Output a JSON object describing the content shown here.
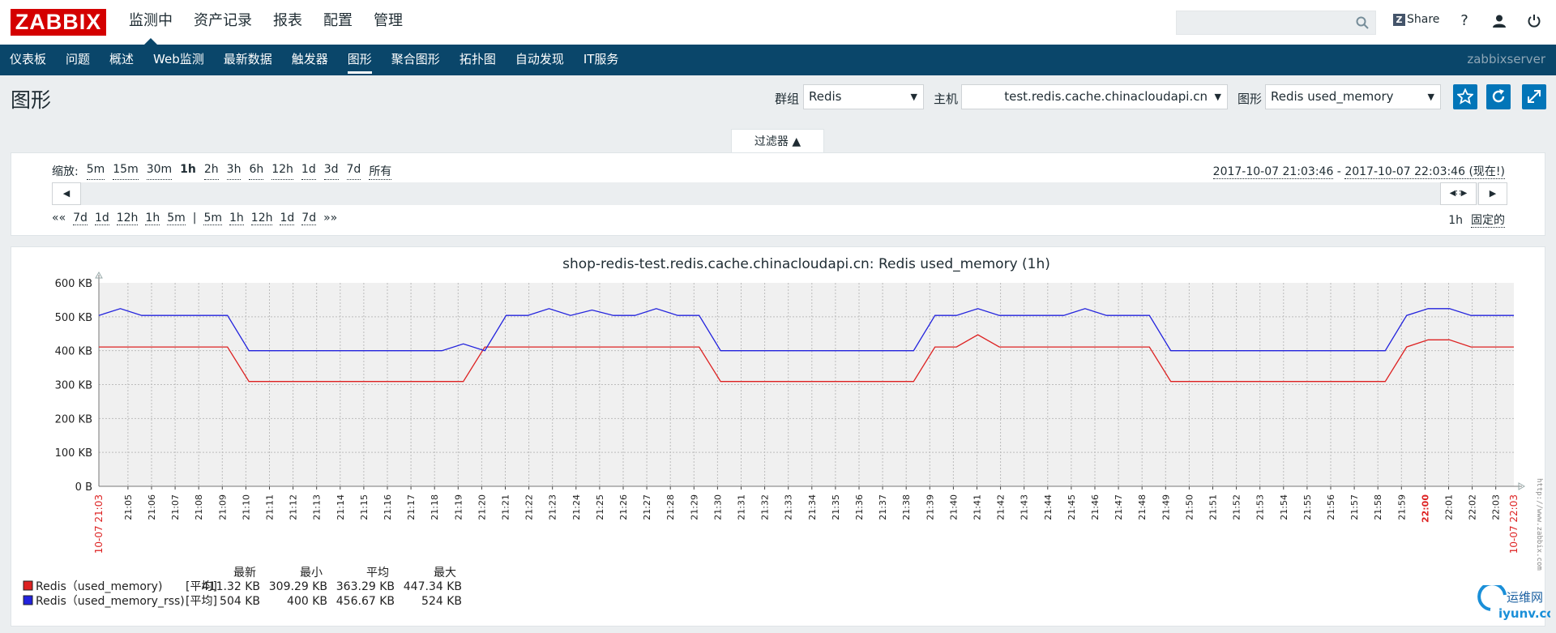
{
  "header": {
    "logo": "ZABBIX",
    "menu": [
      {
        "label": "监测中",
        "active": true
      },
      {
        "label": "资产记录",
        "active": false
      },
      {
        "label": "报表",
        "active": false
      },
      {
        "label": "配置",
        "active": false
      },
      {
        "label": "管理",
        "active": false
      }
    ],
    "search_placeholder": "",
    "share_label": "Share",
    "help_icon": "question-icon",
    "user_icon": "user-icon",
    "logout_icon": "power-icon"
  },
  "subnav": {
    "items": [
      {
        "label": "仪表板",
        "active": false
      },
      {
        "label": "问题",
        "active": false
      },
      {
        "label": "概述",
        "active": false
      },
      {
        "label": "Web监测",
        "active": false
      },
      {
        "label": "最新数据",
        "active": false
      },
      {
        "label": "触发器",
        "active": false
      },
      {
        "label": "图形",
        "active": true
      },
      {
        "label": "聚合图形",
        "active": false
      },
      {
        "label": "拓扑图",
        "active": false
      },
      {
        "label": "自动发现",
        "active": false
      },
      {
        "label": "IT服务",
        "active": false
      }
    ],
    "server_name": "zabbixserver"
  },
  "page": {
    "title": "图形",
    "group_label": "群组",
    "group_value": "Redis",
    "host_label": "主机",
    "host_value": "test.redis.cache.chinacloudapi.cn",
    "graph_label": "图形",
    "graph_value": "Redis used_memory"
  },
  "filter": {
    "tab_label": "过滤器 ▲",
    "zoom_label": "缩放:",
    "zoom_options": [
      "5m",
      "15m",
      "30m",
      "1h",
      "2h",
      "3h",
      "6h",
      "12h",
      "1d",
      "3d",
      "7d",
      "所有"
    ],
    "zoom_current": "1h",
    "range_from": "2017-10-07 21:03:46",
    "range_sep": " - ",
    "range_to": "2017-10-07 22:03:46 (现在!)",
    "nav_left": [
      "««",
      "7d",
      "1d",
      "12h",
      "1h",
      "5m",
      "|",
      "5m",
      "1h",
      "12h",
      "1d",
      "7d",
      "»»"
    ],
    "period_value": "1h",
    "fixed_label": "固定的"
  },
  "chart_data": {
    "type": "line",
    "title": "shop-redis-test.redis.cache.chinacloudapi.cn: Redis used_memory (1h)",
    "y_ticks": [
      "600 KB",
      "500 KB",
      "400 KB",
      "300 KB",
      "200 KB",
      "100 KB",
      "0 B"
    ],
    "ylim": [
      0,
      600
    ],
    "x_ticks": [
      "21:05",
      "21:06",
      "21:07",
      "21:08",
      "21:09",
      "21:10",
      "21:11",
      "21:12",
      "21:13",
      "21:14",
      "21:15",
      "21:16",
      "21:17",
      "21:18",
      "21:19",
      "21:20",
      "21:21",
      "21:22",
      "21:23",
      "21:24",
      "21:25",
      "21:26",
      "21:27",
      "21:28",
      "21:29",
      "21:30",
      "21:31",
      "21:32",
      "21:33",
      "21:34",
      "21:35",
      "21:36",
      "21:37",
      "21:38",
      "21:39",
      "21:40",
      "21:41",
      "21:42",
      "21:43",
      "21:44",
      "21:45",
      "21:46",
      "21:47",
      "21:48",
      "21:49",
      "21:50",
      "21:51",
      "21:52",
      "21:53",
      "21:54",
      "21:55",
      "21:56",
      "21:57",
      "21:58",
      "21:59",
      "22:00",
      "22:01",
      "22:02",
      "22:03"
    ],
    "x_start_label": "10-07 21:03",
    "x_end_label": "10-07 22:03",
    "x_highlight": "22:00",
    "series": [
      {
        "name": "Redis（used_memory)",
        "color": "#dd2222",
        "values": [
          411,
          411,
          411,
          411,
          411,
          411,
          411,
          309,
          309,
          309,
          309,
          309,
          309,
          309,
          309,
          309,
          309,
          309,
          411,
          411,
          411,
          411,
          411,
          411,
          411,
          411,
          411,
          411,
          411,
          309,
          309,
          309,
          309,
          309,
          309,
          309,
          309,
          309,
          309,
          411,
          411,
          447,
          411,
          411,
          411,
          411,
          411,
          411,
          411,
          411,
          309,
          309,
          309,
          309,
          309,
          309,
          309,
          309,
          309,
          309,
          309,
          411,
          432,
          432,
          411,
          411,
          411
        ],
        "stats_tag": "[平均]",
        "last": "411.32 KB",
        "min": "309.29 KB",
        "avg": "363.29 KB",
        "max": "447.34 KB"
      },
      {
        "name": "Redis（used_memory_rss)",
        "color": "#2222dd",
        "values": [
          504,
          524,
          504,
          504,
          504,
          504,
          504,
          400,
          400,
          400,
          400,
          400,
          400,
          400,
          400,
          400,
          400,
          420,
          400,
          504,
          504,
          524,
          504,
          520,
          504,
          504,
          524,
          504,
          504,
          400,
          400,
          400,
          400,
          400,
          400,
          400,
          400,
          400,
          400,
          504,
          504,
          524,
          504,
          504,
          504,
          504,
          524,
          504,
          504,
          504,
          400,
          400,
          400,
          400,
          400,
          400,
          400,
          400,
          400,
          400,
          400,
          504,
          524,
          524,
          504,
          504,
          504
        ],
        "stats_tag": "[平均]",
        "last": "504 KB",
        "min": "400 KB",
        "avg": "456.67 KB",
        "max": "524 KB"
      }
    ],
    "legend_headers": [
      "最新",
      "最小",
      "平均",
      "最大"
    ],
    "side_text": "http://www.zabbix.com"
  },
  "watermark": {
    "text1": "运维网",
    "text2": "iyunv.com"
  }
}
